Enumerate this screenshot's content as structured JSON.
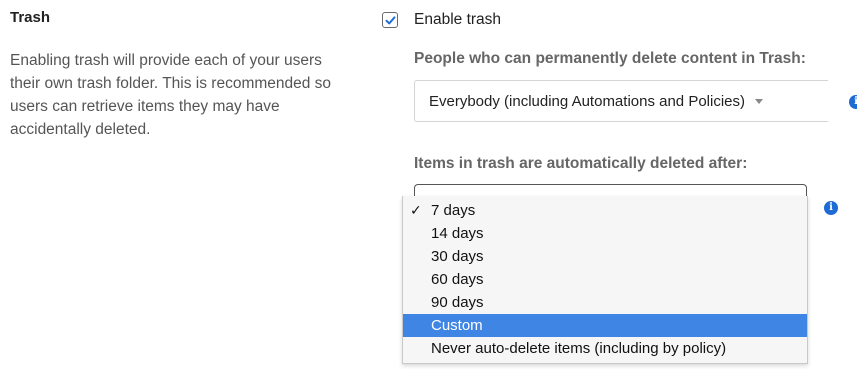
{
  "section": {
    "title": "Trash",
    "description": "Enabling trash will provide each of your users their own trash folder. This is recommended so users can retrieve items they may have accidentally deleted."
  },
  "enable_trash": {
    "label": "Enable trash",
    "checked": true
  },
  "permanent_delete": {
    "label": "People who can permanently delete content in Trash:",
    "selected_value": "Everybody (including Automations and Policies)"
  },
  "auto_delete": {
    "label": "Items in trash are automatically deleted after:",
    "selected_value": "7 days",
    "highlighted_value": "Custom",
    "options": [
      "7 days",
      "14 days",
      "30 days",
      "60 days",
      "90 days",
      "Custom",
      "Never auto-delete items (including by policy)"
    ]
  },
  "icons": {
    "checkbox_check": "checkmark-icon",
    "select_caret": "caret-down-icon",
    "info": "info-icon",
    "selected_option_mark": "checkmark-icon"
  },
  "colors": {
    "checkbox_check": "#1f6bd6",
    "info_icon": "#1f6bd6",
    "highlight": "#3f85e4"
  }
}
